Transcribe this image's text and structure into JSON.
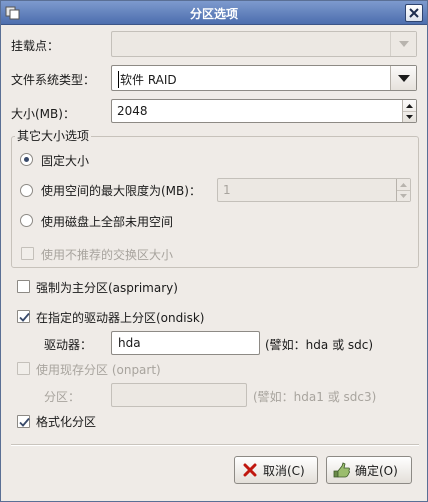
{
  "window": {
    "title": "分区选项"
  },
  "mount_point": {
    "label": "挂载点：",
    "value": ""
  },
  "fs_type": {
    "label": "文件系统类型：",
    "value": "软件 RAID"
  },
  "size": {
    "label": "大小(MB)：",
    "value": "2048"
  },
  "other_size": {
    "frame_title": "其它大小选项",
    "fixed_label": "固定大小",
    "fill_up_to_label": "使用空间的最大限度为(MB)：",
    "fill_up_to_value": "1",
    "fill_all_label": "使用磁盘上全部未用空间",
    "recommended_swap_label": "使用不推荐的交换区大小"
  },
  "force_primary": {
    "label": "强制为主分区(asprimary)",
    "checked": false
  },
  "ondisk": {
    "label": "在指定的驱动器上分区(ondisk)",
    "checked": true,
    "drive_label": "驱动器：",
    "drive_value": "hda",
    "drive_hint": "(譬如：hda 或 sdc)"
  },
  "onpart": {
    "label": "使用现存分区 (onpart)",
    "checked": false,
    "partition_label": "分区：",
    "partition_value": "",
    "partition_hint": "(譬如：hda1 或 sdc3)"
  },
  "format": {
    "label": "格式化分区",
    "checked": true
  },
  "buttons": {
    "cancel": "取消(C)",
    "ok": "确定(O)"
  },
  "colors": {
    "titlebar": "#5b7bb9",
    "window_bg": "#efebe7"
  },
  "icons": {
    "app": "app-icon",
    "close": "close-icon",
    "cancel": "cancel-x-icon",
    "ok": "ok-hand-icon"
  }
}
